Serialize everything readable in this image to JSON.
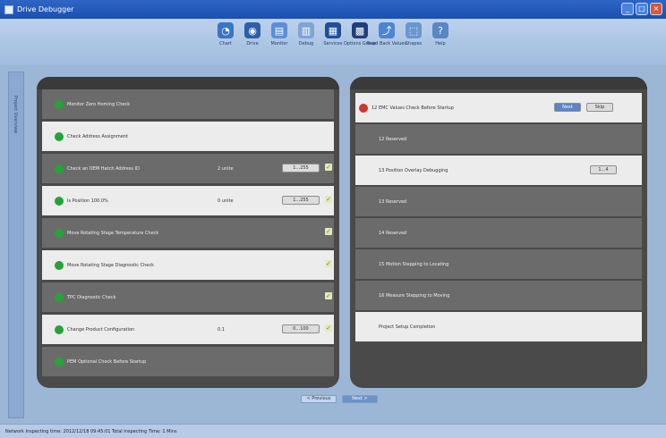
{
  "window": {
    "title": "Drive Debugger",
    "minimize": "_",
    "maximize": "□",
    "close": "×"
  },
  "toolbar": [
    {
      "label": "Chart",
      "icon": "chart-icon",
      "color": "#3a75c4",
      "glyph": "◔"
    },
    {
      "label": "Drive",
      "icon": "drive-icon",
      "color": "#2c5fa8",
      "glyph": "◉"
    },
    {
      "label": "Monitor",
      "icon": "monitor-icon",
      "color": "#5a8fd6",
      "glyph": "▤"
    },
    {
      "label": "Debug",
      "icon": "debug-icon",
      "color": "#7fa3d8",
      "glyph": "▥"
    },
    {
      "label": "Services",
      "icon": "services-icon",
      "color": "#1f4f9a",
      "glyph": "▦"
    },
    {
      "label": "Options Group",
      "icon": "options-icon",
      "color": "#1f3f7a",
      "glyph": "▩"
    },
    {
      "label": "Read Back Values",
      "icon": "readback-icon",
      "color": "#4d86d0",
      "glyph": "⤴"
    },
    {
      "label": "Shapes",
      "icon": "shapes-icon",
      "color": "#6b95cf",
      "glyph": "⬚"
    },
    {
      "label": "Help",
      "icon": "help-icon",
      "color": "#5a86c3",
      "glyph": "?"
    }
  ],
  "sidebar_tab": "Project Overview",
  "left_rows": [
    {
      "label": "Monitor Zero Homing Check",
      "value": "",
      "button": "",
      "mark": false
    },
    {
      "label": "Check Address Assignment",
      "value": "",
      "button": "",
      "mark": false
    },
    {
      "label": "Check an OEM Hatch Address ID",
      "value": "2 unite",
      "button": "1...255",
      "mark": true
    },
    {
      "label": "Is Position 100.0%",
      "value": "0 unite",
      "button": "1...255",
      "mark": true
    },
    {
      "label": "Move Rotating Stage Temperature Check",
      "value": "",
      "button": "",
      "mark": true
    },
    {
      "label": "Move Rotating Stage Diagnostic Check",
      "value": "",
      "button": "",
      "mark": true
    },
    {
      "label": "TPC Diagnostic Check",
      "value": "",
      "button": "",
      "mark": true
    },
    {
      "label": "Change Product Configuration",
      "value": "0.1",
      "button": "0...100",
      "mark": true
    },
    {
      "label": "PEM Optional Check Before Startup",
      "value": "",
      "button": "",
      "mark": false
    }
  ],
  "right_rows": [
    {
      "label": "12 EMC Values Check Before Startup",
      "status": "error",
      "buttons": [
        "Next",
        "Skip"
      ]
    },
    {
      "label": "12 Reserved",
      "status": "",
      "buttons": []
    },
    {
      "label": "13 Position Overlay Debugging",
      "status": "",
      "buttons": [
        "1...4"
      ]
    },
    {
      "label": "13 Reserved",
      "status": "",
      "buttons": []
    },
    {
      "label": "14 Reserved",
      "status": "",
      "buttons": []
    },
    {
      "label": "15 Motion Stepping to Locating",
      "status": "",
      "buttons": []
    },
    {
      "label": "16 Measure Stepping to Moving",
      "status": "",
      "buttons": []
    },
    {
      "label": "Project Setup Completion",
      "status": "",
      "buttons": []
    }
  ],
  "nav": {
    "prev": "< Previous",
    "next": "Next >"
  },
  "status": "Network Inspecting time: 2012/12/18 09:45:01  Total Inspecting Time: 1 Mins",
  "colors": {
    "ok": "#27a23a",
    "error": "#d1362a",
    "title_bar": "#1b4fb0"
  }
}
